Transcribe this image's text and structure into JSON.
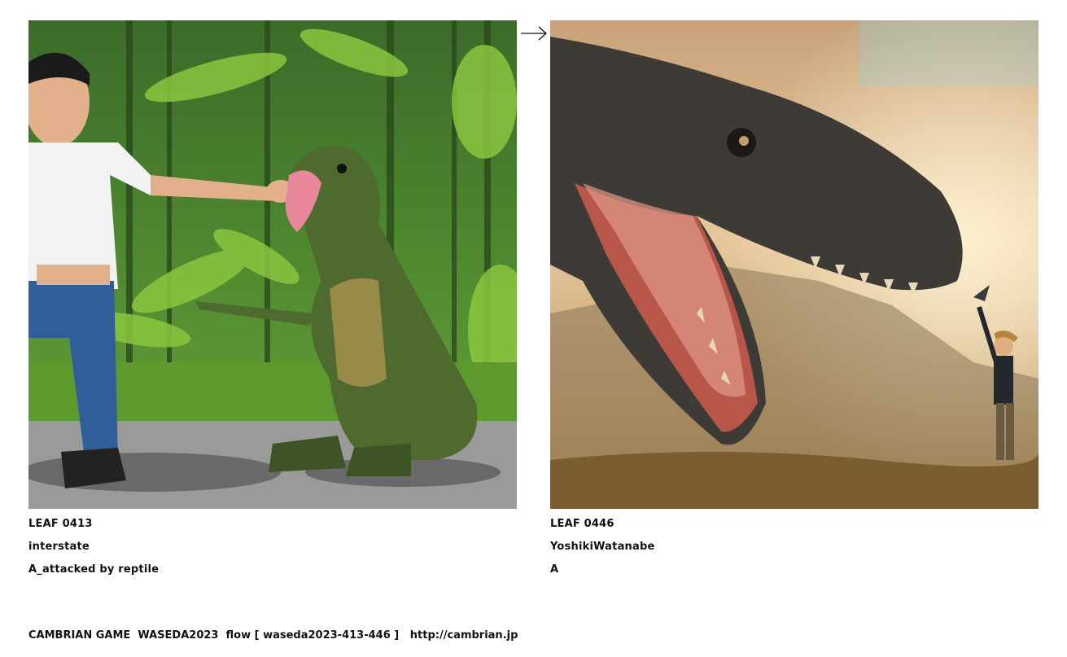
{
  "left_leaf": {
    "leaf_id": "LEAF 0413",
    "author": "interstate",
    "title": "A_attacked by reptile",
    "image_subject": "boy-feeding-green-reptile-in-jungle"
  },
  "right_leaf": {
    "leaf_id": "LEAF 0446",
    "author": "YoshikiWatanabe",
    "title": "A",
    "image_subject": "giant-dinosaur-roaring-at-small-boy"
  },
  "arrow_icon": "right-arrow",
  "footer": {
    "text": "CAMBRIAN GAME  WASEDA2023  flow [ waseda2023-413-446 ]   http://cambrian.jp"
  }
}
